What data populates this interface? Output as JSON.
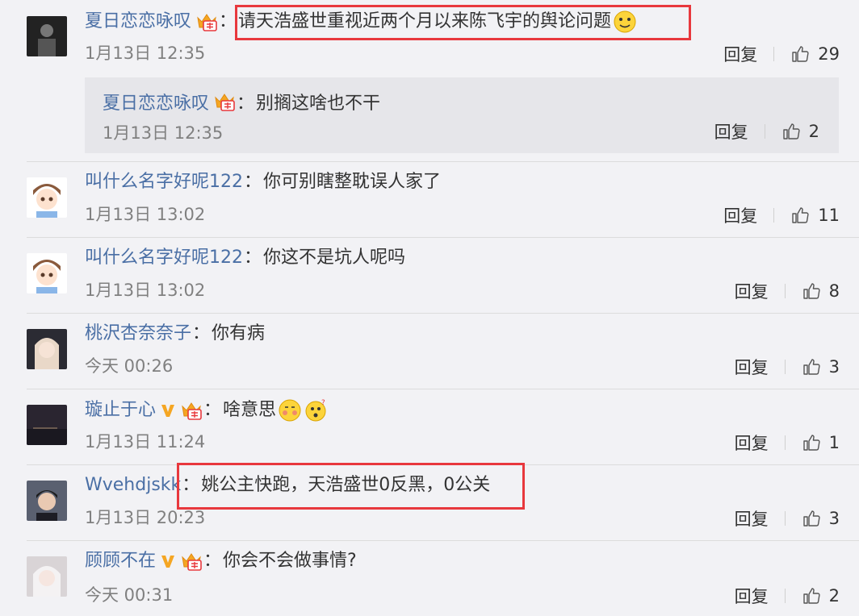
{
  "comments": [
    {
      "user": "夏日恋恋咏叹",
      "text": "请天浩盛世重视近两个月以来陈飞宇的舆论问题",
      "time": "1月13日 12:35",
      "reply": "回复",
      "likes": "29",
      "avatar_icon": "dark-portrait-avatar",
      "badge": "crown-badge-icon",
      "vip": false
    },
    {
      "user": "叫什么名字好呢122",
      "text": "你可别瞎整耽误人家了",
      "time": "1月13日 13:02",
      "reply": "回复",
      "likes": "11",
      "avatar_icon": "cartoon-boy-avatar"
    },
    {
      "user": "叫什么名字好呢122",
      "text": "你这不是坑人呢吗",
      "time": "1月13日 13:02",
      "reply": "回复",
      "likes": "8",
      "avatar_icon": "cartoon-boy-avatar"
    },
    {
      "user": "桃沢杏奈奈子",
      "text": "你有病",
      "time": "今天 00:26",
      "reply": "回复",
      "likes": "3",
      "avatar_icon": "girl-portrait-avatar"
    },
    {
      "user": "璇止于心",
      "text": "啥意思",
      "time": "1月13日 11:24",
      "reply": "回复",
      "likes": "1",
      "avatar_icon": "dark-landscape-avatar"
    },
    {
      "user": "Wvehdjskk",
      "text": "姚公主快跑，天浩盛世0反黑，0公关",
      "time": "1月13日 20:23",
      "reply": "回复",
      "likes": "3",
      "avatar_icon": "man-portrait-avatar"
    },
    {
      "user": "顾顾不在",
      "text": "你会不会做事情?",
      "time": "今天 00:31",
      "reply": "回复",
      "likes": "2",
      "avatar_icon": "white-hair-girl-avatar"
    }
  ],
  "subreply": {
    "user": "夏日恋恋咏叹",
    "text": "别搁这啥也不干",
    "time": "1月13日 12:35",
    "reply": "回复",
    "likes": "2"
  },
  "colon": "：",
  "colors": {
    "username": "#4a6fa5",
    "highlight": "#e8383d",
    "background": "#f2f2f5",
    "subreply_bg": "#e6e6ea",
    "vip": "#f5a623"
  }
}
